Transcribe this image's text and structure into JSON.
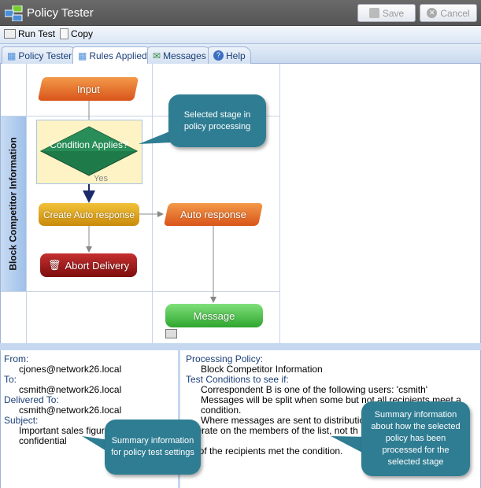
{
  "window": {
    "title": "Policy Tester",
    "save_label": "Save",
    "cancel_label": "Cancel"
  },
  "toolbar": {
    "run_test": "Run Test",
    "copy": "Copy"
  },
  "tabs": [
    {
      "label": "Policy Tester"
    },
    {
      "label": "Rules Applied",
      "active": true
    },
    {
      "label": "Messages"
    },
    {
      "label": "Help"
    }
  ],
  "diagram": {
    "lane_label": "Block Competitor Information",
    "nodes": {
      "input": "Input",
      "condition": "Condition Applies?",
      "yes": "Yes",
      "create_auto": "Create Auto response",
      "auto": "Auto response",
      "abort": "Abort Delivery",
      "message": "Message"
    },
    "colors": {
      "orange": "#e0661c",
      "green": "#1f7a4a",
      "yellow": "#d99a10",
      "red": "#9b1414",
      "message": "#3cb83c",
      "callout": "#2f7d93"
    }
  },
  "callouts": {
    "stage": "Selected stage in policy processing",
    "settings": "Summary information for policy test settings",
    "processed": "Summary information about how the selected policy has been processed for the selected stage"
  },
  "settings": {
    "from_label": "From:",
    "from": "cjones@network26.local",
    "to_label": "To:",
    "to": "csmith@network26.local",
    "delivered_label": "Delivered To:",
    "delivered": "csmith@network26.local",
    "subject_label": "Subject:",
    "subject_1": "Important sales figures",
    "subject_2": "confidential"
  },
  "result": {
    "policy_label": "Processing Policy:",
    "policy": "Block Competitor Information",
    "conditions_label": "Test Conditions to see if:",
    "c1": "Correspondent B is one of the following users: 'csmith'",
    "c2": "Messages will be split when some but not all recipients meet a",
    "c2b": "condition.",
    "c3": "Where messages are sent to distribution g",
    "c3b": "operate on the members of the list, not th",
    "result_label": "ult:",
    "result": "All of the recipients met the condition."
  }
}
